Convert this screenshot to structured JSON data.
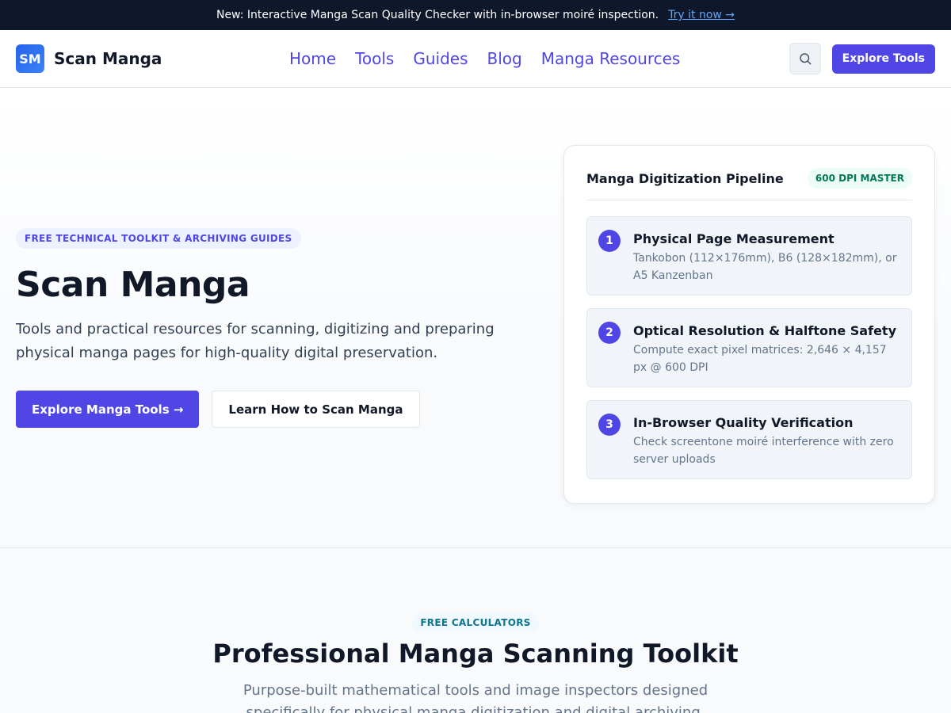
{
  "announcement": {
    "text": "New: Interactive Manga Scan Quality Checker with in-browser moiré inspection.",
    "link_label": "Try it now →"
  },
  "header": {
    "logo_text": "SM",
    "brand": "Scan Manga",
    "nav": [
      "Home",
      "Tools",
      "Guides",
      "Blog",
      "Manga Resources"
    ],
    "search_icon": "search-icon",
    "cta_label": "Explore Tools"
  },
  "hero": {
    "pill": "FREE TECHNICAL TOOLKIT & ARCHIVING GUIDES",
    "title": "Scan Manga",
    "description": "Tools and practical resources for scanning, digitizing and preparing physical manga pages for high-quality digital preservation.",
    "primary_cta": "Explore Manga Tools →",
    "secondary_cta": "Learn How to Scan Manga"
  },
  "pipeline": {
    "title": "Manga Digitization Pipeline",
    "badge": "600 DPI MASTER",
    "steps": [
      {
        "num": "1",
        "title": "Physical Page Measurement",
        "desc": "Tankobon (112×176mm), B6 (128×182mm), or A5 Kanzenban"
      },
      {
        "num": "2",
        "title": "Optical Resolution & Halftone Safety",
        "desc": "Compute exact pixel matrices: 2,646 × 4,157 px @ 600 DPI"
      },
      {
        "num": "3",
        "title": "In-Browser Quality Verification",
        "desc": "Check screentone moiré interference with zero server uploads"
      }
    ]
  },
  "toolkit": {
    "pill": "FREE CALCULATORS",
    "title": "Professional Manga Scanning Toolkit",
    "description": "Purpose-built mathematical tools and image inspectors designed specifically for physical manga digitization and digital archiving."
  },
  "colors": {
    "accent": "#4f46e5",
    "announce_bg": "#0f172a",
    "link": "#60a5fa",
    "badge_green": "#047857"
  }
}
